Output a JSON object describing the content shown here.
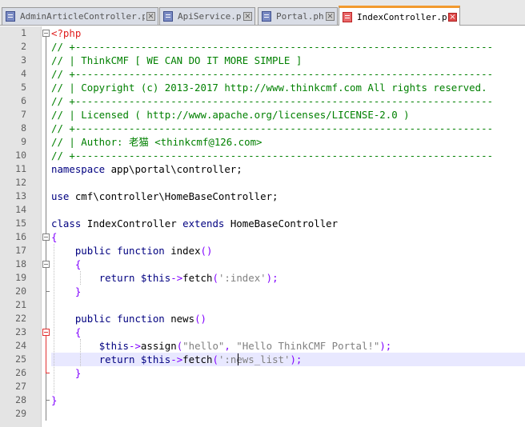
{
  "tabs": [
    {
      "label": "AdminArticleController.php",
      "active": false
    },
    {
      "label": "ApiService.php",
      "active": false
    },
    {
      "label": "Portal.php",
      "active": false
    },
    {
      "label": "IndexController.php",
      "active": true
    }
  ],
  "editor": {
    "current_line": 25,
    "lines": [
      {
        "n": "1",
        "tokens": [
          {
            "t": "<?php",
            "c": "tag"
          }
        ]
      },
      {
        "n": "2",
        "tokens": [
          {
            "t": "// +----------------------------------------------------------------------",
            "c": "com"
          }
        ]
      },
      {
        "n": "3",
        "tokens": [
          {
            "t": "// | ThinkCMF [ WE CAN DO IT MORE SIMPLE ]",
            "c": "com"
          }
        ]
      },
      {
        "n": "4",
        "tokens": [
          {
            "t": "// +----------------------------------------------------------------------",
            "c": "com"
          }
        ]
      },
      {
        "n": "5",
        "tokens": [
          {
            "t": "// | Copyright (c) 2013-2017 http://www.thinkcmf.com All rights reserved.",
            "c": "com"
          }
        ]
      },
      {
        "n": "6",
        "tokens": [
          {
            "t": "// +----------------------------------------------------------------------",
            "c": "com"
          }
        ]
      },
      {
        "n": "7",
        "tokens": [
          {
            "t": "// | Licensed ( http://www.apache.org/licenses/LICENSE-2.0 )",
            "c": "com"
          }
        ]
      },
      {
        "n": "8",
        "tokens": [
          {
            "t": "// +----------------------------------------------------------------------",
            "c": "com"
          }
        ]
      },
      {
        "n": "9",
        "tokens": [
          {
            "t": "// | Author: 老猫 <thinkcmf@126.com>",
            "c": "com"
          }
        ]
      },
      {
        "n": "10",
        "tokens": [
          {
            "t": "// +----------------------------------------------------------------------",
            "c": "com"
          }
        ]
      },
      {
        "n": "11",
        "tokens": [
          {
            "t": "namespace",
            "c": "kw"
          },
          {
            "t": " app\\portal\\controller;",
            "c": ""
          }
        ]
      },
      {
        "n": "12",
        "tokens": []
      },
      {
        "n": "13",
        "tokens": [
          {
            "t": "use",
            "c": "kw"
          },
          {
            "t": " cmf\\controller\\HomeBaseController;",
            "c": ""
          }
        ]
      },
      {
        "n": "14",
        "tokens": []
      },
      {
        "n": "15",
        "tokens": [
          {
            "t": "class",
            "c": "kw"
          },
          {
            "t": " IndexController ",
            "c": ""
          },
          {
            "t": "extends",
            "c": "kw"
          },
          {
            "t": " HomeBaseController",
            "c": ""
          }
        ]
      },
      {
        "n": "16",
        "tokens": [
          {
            "t": "{",
            "c": "op"
          }
        ]
      },
      {
        "n": "17",
        "tokens": [
          {
            "t": "    ",
            "c": ""
          },
          {
            "t": "public",
            "c": "kw"
          },
          {
            "t": " ",
            "c": ""
          },
          {
            "t": "function",
            "c": "kw"
          },
          {
            "t": " index",
            "c": ""
          },
          {
            "t": "()",
            "c": "op"
          }
        ]
      },
      {
        "n": "18",
        "tokens": [
          {
            "t": "    ",
            "c": ""
          },
          {
            "t": "{",
            "c": "op"
          }
        ]
      },
      {
        "n": "19",
        "tokens": [
          {
            "t": "        ",
            "c": ""
          },
          {
            "t": "return",
            "c": "kw"
          },
          {
            "t": " ",
            "c": ""
          },
          {
            "t": "$this",
            "c": "var"
          },
          {
            "t": "->",
            "c": "op"
          },
          {
            "t": "fetch",
            "c": ""
          },
          {
            "t": "(",
            "c": "op"
          },
          {
            "t": "':index'",
            "c": "str"
          },
          {
            "t": ");",
            "c": "op"
          }
        ]
      },
      {
        "n": "20",
        "tokens": [
          {
            "t": "    ",
            "c": ""
          },
          {
            "t": "}",
            "c": "op"
          }
        ]
      },
      {
        "n": "21",
        "tokens": []
      },
      {
        "n": "22",
        "tokens": [
          {
            "t": "    ",
            "c": ""
          },
          {
            "t": "public",
            "c": "kw"
          },
          {
            "t": " ",
            "c": ""
          },
          {
            "t": "function",
            "c": "kw"
          },
          {
            "t": " news",
            "c": ""
          },
          {
            "t": "()",
            "c": "op"
          }
        ]
      },
      {
        "n": "23",
        "tokens": [
          {
            "t": "    ",
            "c": ""
          },
          {
            "t": "{",
            "c": "op"
          }
        ]
      },
      {
        "n": "24",
        "tokens": [
          {
            "t": "        ",
            "c": ""
          },
          {
            "t": "$this",
            "c": "var"
          },
          {
            "t": "->",
            "c": "op"
          },
          {
            "t": "assign",
            "c": ""
          },
          {
            "t": "(",
            "c": "op"
          },
          {
            "t": "\"hello\"",
            "c": "str"
          },
          {
            "t": ", ",
            "c": "op"
          },
          {
            "t": "\"Hello ThinkCMF Portal!\"",
            "c": "str"
          },
          {
            "t": ");",
            "c": "op"
          }
        ]
      },
      {
        "n": "25",
        "tokens": [
          {
            "t": "        ",
            "c": ""
          },
          {
            "t": "return",
            "c": "kw"
          },
          {
            "t": " ",
            "c": ""
          },
          {
            "t": "$this",
            "c": "var"
          },
          {
            "t": "->",
            "c": "op"
          },
          {
            "t": "fetch",
            "c": ""
          },
          {
            "t": "(",
            "c": "op"
          },
          {
            "t": "':news_list'",
            "c": "str"
          },
          {
            "t": ");",
            "c": "op"
          }
        ]
      },
      {
        "n": "26",
        "tokens": [
          {
            "t": "    ",
            "c": ""
          },
          {
            "t": "}",
            "c": "op"
          }
        ]
      },
      {
        "n": "27",
        "tokens": []
      },
      {
        "n": "28",
        "tokens": [
          {
            "t": "}",
            "c": "op"
          }
        ]
      },
      {
        "n": "29",
        "tokens": []
      }
    ]
  }
}
